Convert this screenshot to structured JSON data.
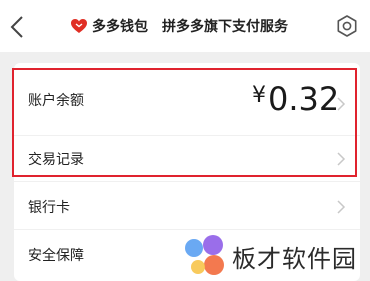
{
  "header": {
    "brand": "多多钱包",
    "subtitle": "拼多多旗下支付服务"
  },
  "balance": {
    "label": "账户余额",
    "currency": "¥",
    "amount": "0.32"
  },
  "menu": {
    "items": [
      {
        "label": "交易记录"
      },
      {
        "label": "银行卡"
      },
      {
        "label": "安全保障"
      }
    ]
  },
  "watermark": {
    "text": "板才软件园"
  },
  "colors": {
    "brand_red": "#e02e24",
    "highlight_red": "#e0232e",
    "background": "#efefef"
  }
}
